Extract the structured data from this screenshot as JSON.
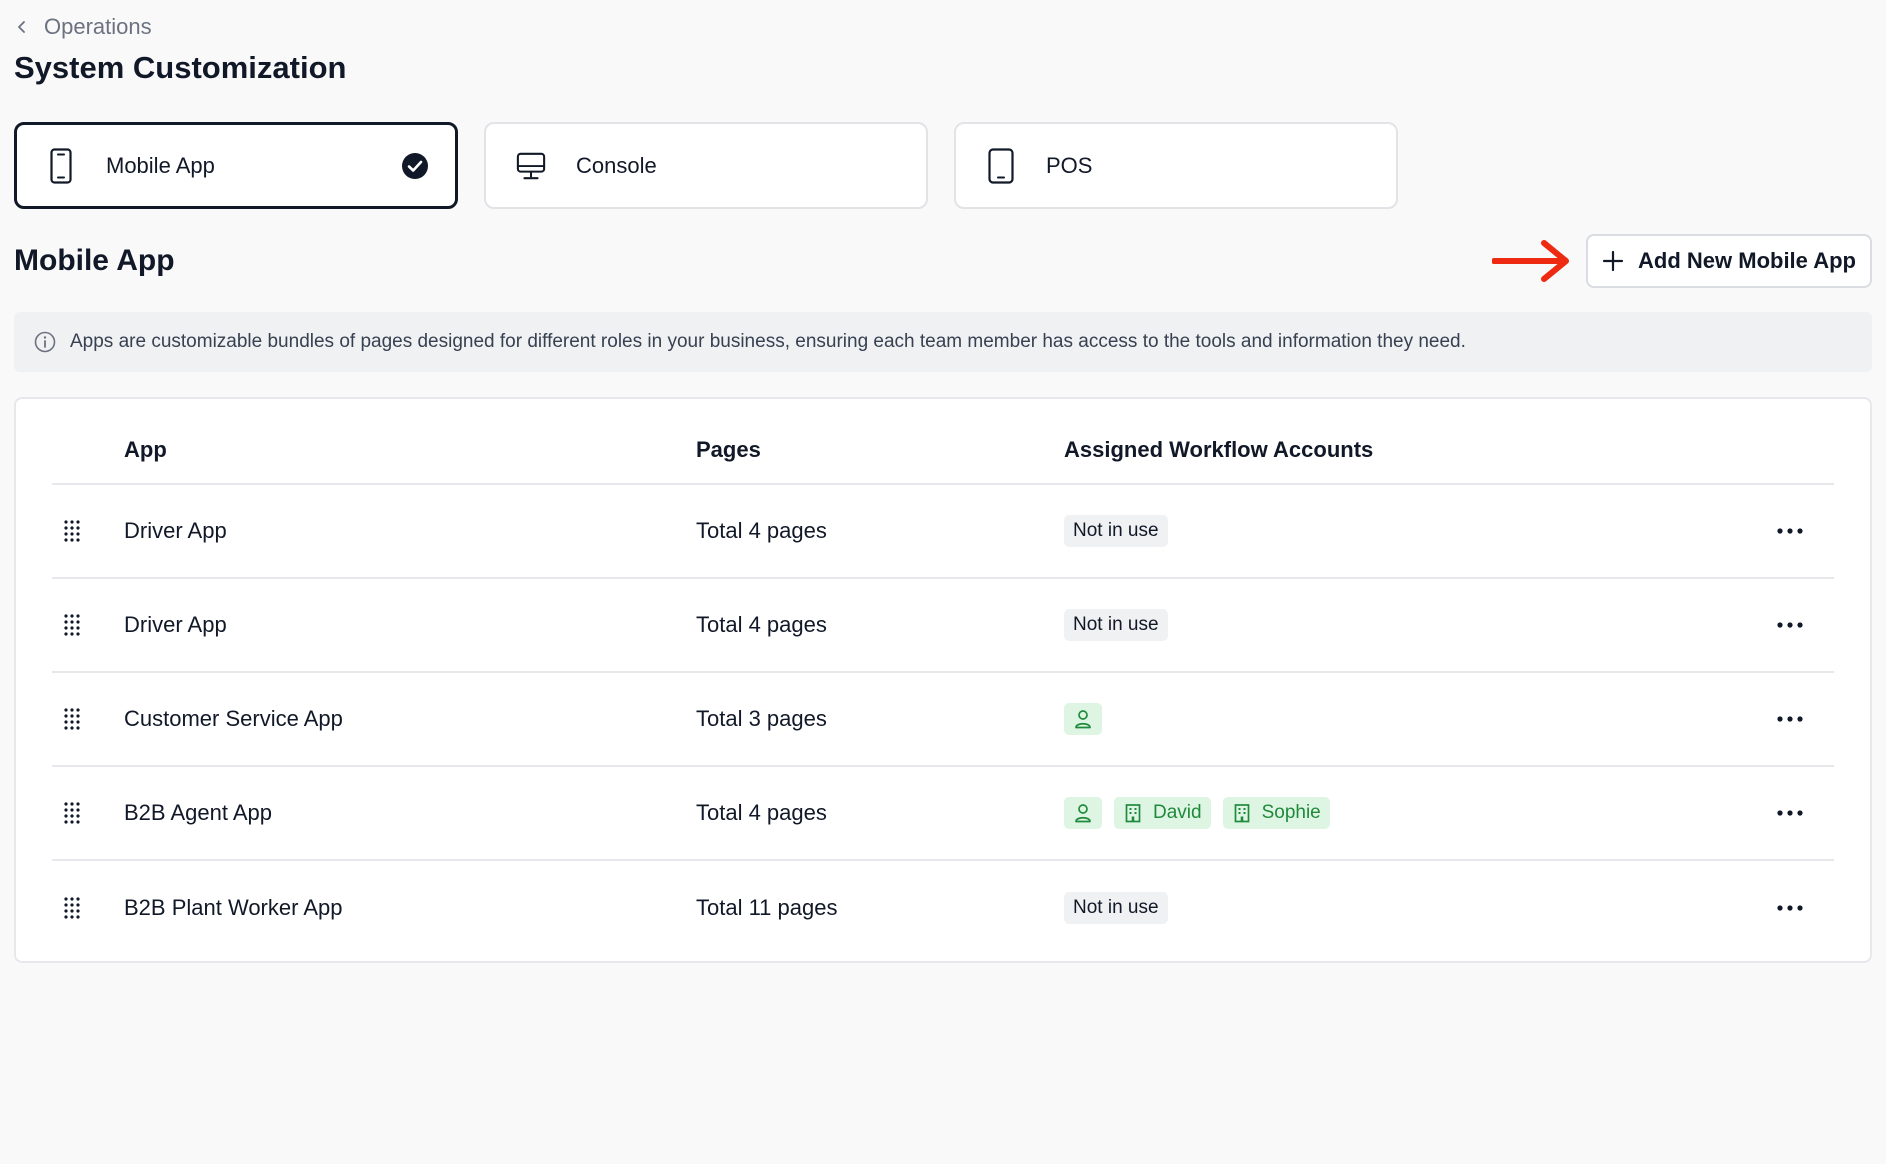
{
  "breadcrumb": {
    "label": "Operations"
  },
  "page": {
    "title": "System Customization"
  },
  "type_cards": [
    {
      "label": "Mobile App",
      "icon": "smartphone-icon",
      "selected": true
    },
    {
      "label": "Console",
      "icon": "monitor-icon",
      "selected": false
    },
    {
      "label": "POS",
      "icon": "tablet-icon",
      "selected": false
    }
  ],
  "section": {
    "title": "Mobile App"
  },
  "add_button": {
    "label": "Add New Mobile App"
  },
  "info_banner": {
    "text": "Apps are customizable bundles of pages designed for different roles in your business, ensuring each team member has access to the tools and information they need."
  },
  "table": {
    "columns": [
      "App",
      "Pages",
      "Assigned Workflow Accounts"
    ],
    "rows": [
      {
        "app": "Driver App",
        "pages": "Total 4 pages",
        "accounts_text": "Not in use"
      },
      {
        "app": "Driver App",
        "pages": "Total 4 pages",
        "accounts_text": "Not in use"
      },
      {
        "app": "Customer Service App",
        "pages": "Total 3 pages",
        "accounts_text": ""
      },
      {
        "app": "B2B Agent App",
        "pages": "Total 4 pages",
        "accounts": [
          "David",
          "Sophie"
        ]
      },
      {
        "app": "B2B Plant Worker App",
        "pages": "Total 11 pages",
        "accounts_text": "Not in use"
      }
    ]
  },
  "colors": {
    "accent_dark": "#111827",
    "annotation_arrow": "#ee2a12",
    "badge_green_bg": "#dff5e3",
    "badge_green_text": "#1f8a3b"
  }
}
